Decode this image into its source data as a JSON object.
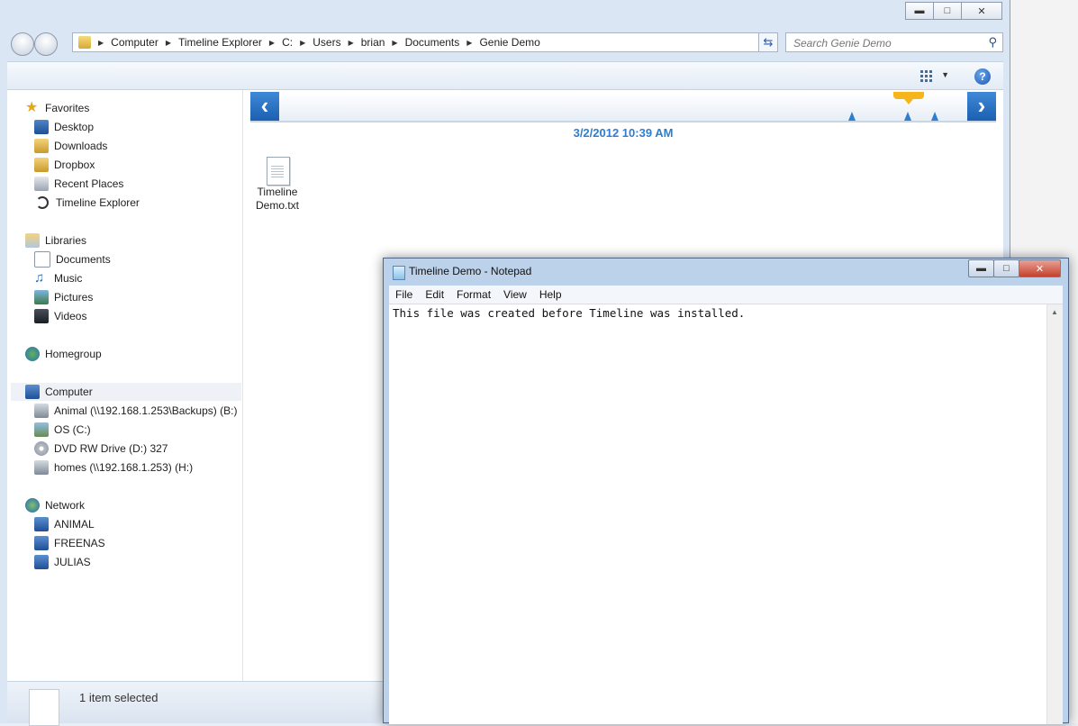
{
  "explorer": {
    "address": [
      "Computer",
      "Timeline Explorer",
      "C:",
      "Users",
      "brian",
      "Documents",
      "Genie Demo"
    ],
    "search_placeholder": "Search Genie Demo",
    "favorites": {
      "header": "Favorites",
      "items": [
        "Desktop",
        "Downloads",
        "Dropbox",
        "Recent Places",
        "Timeline Explorer"
      ]
    },
    "libraries": {
      "header": "Libraries",
      "items": [
        "Documents",
        "Music",
        "Pictures",
        "Videos"
      ]
    },
    "homegroup": "Homegroup",
    "computer": {
      "header": "Computer",
      "items": [
        "Animal (\\\\192.168.1.253\\Backups) (B:)",
        "OS (C:)",
        "DVD RW Drive (D:) 327",
        "homes (\\\\192.168.1.253) (H:)"
      ]
    },
    "network": {
      "header": "Network",
      "items": [
        "ANIMAL",
        "FREENAS",
        "JULIAS"
      ]
    },
    "timeline_date": "3/2/2012 10:39 AM",
    "file": {
      "line1": "Timeline",
      "line2": "Demo.txt"
    },
    "status": "1 item selected"
  },
  "notepad": {
    "title": "Timeline Demo - Notepad",
    "menu": [
      "File",
      "Edit",
      "Format",
      "View",
      "Help"
    ],
    "content": "This file was created before Timeline was installed."
  },
  "colors": {
    "accent": "#2f7ecb",
    "timeline_marker": "#f6b51b",
    "close_red": "#c4412c"
  }
}
